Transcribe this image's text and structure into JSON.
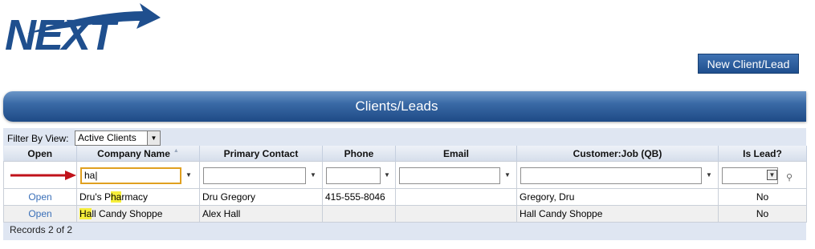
{
  "brand": {
    "logo_text": "NEXT"
  },
  "header": {
    "new_button_label": "New Client/Lead"
  },
  "banner": {
    "title": "Clients/Leads"
  },
  "filter": {
    "label": "Filter By View:",
    "selected": "Active Clients"
  },
  "grid": {
    "columns": [
      "Open",
      "Company Name",
      "Primary Contact",
      "Phone",
      "Email",
      "Customer:Job (QB)",
      "Is Lead?"
    ],
    "company_filter_value": "ha",
    "rows": [
      {
        "open": "Open",
        "company_pre": "Dru's P",
        "company_hl": "ha",
        "company_post": "rmacy",
        "contact": "Dru Gregory",
        "phone": "415-555-8046",
        "email": "",
        "customer_job": "Gregory, Dru",
        "is_lead": "No"
      },
      {
        "open": "Open",
        "company_pre": "",
        "company_hl": "Ha",
        "company_post": "ll Candy Shoppe",
        "contact": "Alex Hall",
        "phone": "",
        "email": "",
        "customer_job": "Hall Candy Shoppe",
        "is_lead": "No"
      }
    ],
    "records_text": "Records 2 of 2"
  },
  "colors": {
    "accent": "#1f4f8e",
    "highlight": "#f6ee3a",
    "arrow": "#c0121a"
  }
}
